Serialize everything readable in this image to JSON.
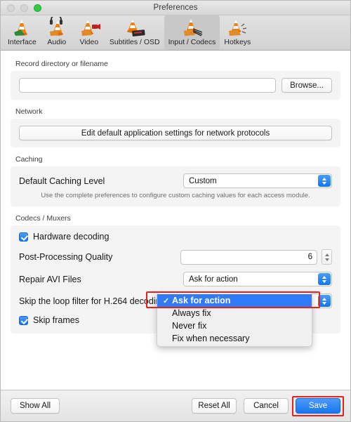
{
  "window": {
    "title": "Preferences",
    "traffic_lights": [
      "close",
      "minimize",
      "zoom"
    ]
  },
  "toolbar": {
    "items": [
      {
        "label": "Interface",
        "icon": "vlc-cone-interface-icon",
        "active": false
      },
      {
        "label": "Audio",
        "icon": "vlc-cone-audio-icon",
        "active": false
      },
      {
        "label": "Video",
        "icon": "vlc-cone-video-icon",
        "active": false
      },
      {
        "label": "Subtitles / OSD",
        "icon": "vlc-cone-subtitles-icon",
        "active": false
      },
      {
        "label": "Input / Codecs",
        "icon": "vlc-cone-input-icon",
        "active": true
      },
      {
        "label": "Hotkeys",
        "icon": "vlc-cone-hotkeys-icon",
        "active": false
      }
    ]
  },
  "record": {
    "section_label": "Record directory or filename",
    "path_value": "",
    "path_placeholder": "",
    "browse_label": "Browse..."
  },
  "network": {
    "section_label": "Network",
    "edit_button_label": "Edit default application settings for network protocols"
  },
  "caching": {
    "section_label": "Caching",
    "level_label": "Default Caching Level",
    "level_value": "Custom",
    "hint": "Use the complete preferences to configure custom caching values for each access module."
  },
  "codecs": {
    "section_label": "Codecs / Muxers",
    "hardware_decoding_label": "Hardware decoding",
    "hardware_decoding_checked": true,
    "post_processing_label": "Post-Processing Quality",
    "post_processing_value": "6",
    "repair_avi_label": "Repair AVI Files",
    "repair_avi_value": "Ask for action",
    "skip_loop_filter_label": "Skip the loop filter for H.264 decoding",
    "skip_frames_label": "Skip frames",
    "skip_frames_checked": true
  },
  "repair_avi_dropdown": {
    "open": true,
    "options": [
      {
        "label": "Ask for action",
        "selected": true
      },
      {
        "label": "Always fix",
        "selected": false
      },
      {
        "label": "Never fix",
        "selected": false
      },
      {
        "label": "Fix when necessary",
        "selected": false
      }
    ],
    "checkmark": "✓"
  },
  "footer": {
    "show_all_label": "Show All",
    "reset_all_label": "Reset All",
    "cancel_label": "Cancel",
    "save_label": "Save"
  },
  "annotations": {
    "highlight_color": "#e8211a",
    "highlighted": [
      "repair-avi-selected-option",
      "save-button"
    ]
  },
  "colors": {
    "accent_blue": "#1277f2",
    "selection_blue": "#2f7cf6",
    "zoom_green": "#2ecc40",
    "group_bg": "#f4f4f4"
  }
}
